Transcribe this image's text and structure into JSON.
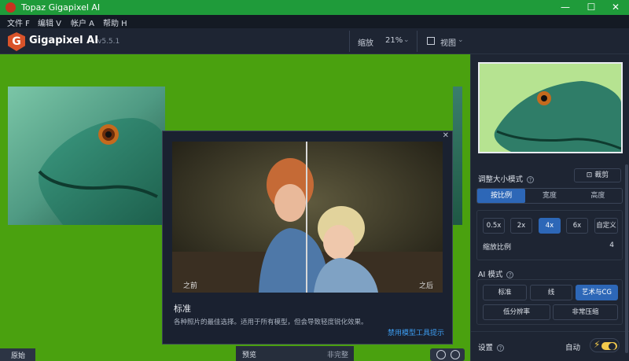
{
  "window": {
    "title": "Topaz Gigapixel AI",
    "minimize": "—",
    "maximize": "☐",
    "close": "✕"
  },
  "menu": [
    "文件 F",
    "编辑 V",
    "帐户 A",
    "帮助 H"
  ],
  "header": {
    "brand": "Gigapixel AI",
    "version": "v5.5.1",
    "zoom_label": "缩放",
    "zoom_value": "21%",
    "view_label": "视图"
  },
  "canvas": {
    "background_color": "#4aa10f",
    "bottom_left_label": "原始",
    "preview_label": "预览",
    "preview_right": "非完整"
  },
  "popup": {
    "close": "✕",
    "before_label": "之前",
    "after_label": "之后",
    "heading": "标准",
    "description": "各种照片的最佳选择。适用于所有模型，但会导致轻度锐化效果。",
    "link": "禁用模型工具提示"
  },
  "panel": {
    "resize_title": "调整大小模式",
    "crop_button": "裁剪",
    "tabs": [
      "按比例",
      "宽度",
      "高度"
    ],
    "active_tab": 0,
    "scale_buttons": [
      "0.5x",
      "2x",
      "4x",
      "6x",
      "自定义"
    ],
    "active_scale": 2,
    "scale_label": "缩放比例",
    "scale_value": "4",
    "ai_title": "AI 模式",
    "ai_buttons_row1": [
      "标准",
      "线",
      "艺术与CG"
    ],
    "ai_buttons_row2": [
      "低分辨率",
      "非常压缩"
    ],
    "active_ai": 2,
    "settings_title": "设置",
    "auto_label": "自动"
  },
  "colors": {
    "accent": "#2d67b7",
    "titlebar": "#1f9b3a",
    "toggle": "#f2c94c",
    "link": "#3c9cf0"
  }
}
